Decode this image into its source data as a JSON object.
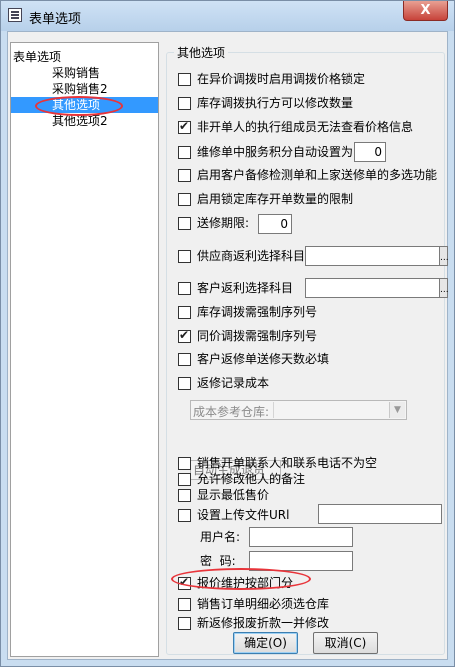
{
  "window": {
    "title": "表单选项",
    "close": "X"
  },
  "tree": {
    "root": "表单选项",
    "items": [
      "采购销售",
      "采购销售2",
      "其他选项",
      "其他选项2"
    ],
    "selected_index": 2
  },
  "group": {
    "title": "其他选项"
  },
  "options": {
    "o1": {
      "label": "在异价调拨时启用调拨价格锁定",
      "checked": false
    },
    "o2": {
      "label": "库存调拨执行方可以修改数量",
      "checked": false
    },
    "o3": {
      "label": "非开单人的执行组成员无法查看价格信息",
      "checked": true
    },
    "o4": {
      "label": "维修单中服务积分自动设置为",
      "checked": false,
      "value": "0"
    },
    "o5": {
      "label": "启用客户备修检测单和上家送修单的多选功能",
      "checked": false
    },
    "o6": {
      "label": "启用锁定库存开单数量的限制",
      "checked": false
    },
    "o7": {
      "label": "送修期限:",
      "checked": false,
      "value": "0"
    },
    "o8": {
      "label": "供应商返利选择科目",
      "checked": false,
      "value": ""
    },
    "o9": {
      "label": "客户返利选择科目",
      "checked": false,
      "value": ""
    },
    "o10": {
      "label": "库存调拨需强制序列号",
      "checked": false
    },
    "o11": {
      "label": "同价调拨需强制序列号",
      "checked": true
    },
    "o12": {
      "label": "客户返修单送修天数必填",
      "checked": false
    },
    "o13": {
      "label": "返修记录成本",
      "checked": false
    },
    "cost_warehouse_label": "成本参考仓库:",
    "cost_warehouse_value": "",
    "auto_return_label": "自动生成退货",
    "o14": {
      "label": "销售开单联系人和联系电话不为空",
      "checked": false
    },
    "o15": {
      "label": "允许修改他人的备注",
      "checked": false
    },
    "o16": {
      "label": "显示最低售价",
      "checked": false
    },
    "o17": {
      "label": "设置上传文件URl",
      "checked": false,
      "value": ""
    },
    "username_label": "用户名:",
    "username_value": "",
    "password_label": "密  码:",
    "password_value": "",
    "o18": {
      "label": "报价维护按部门分",
      "checked": true
    },
    "o19": {
      "label": "销售订单明细必须选仓库",
      "checked": false
    },
    "o20": {
      "label": "新返修报废折款一并修改",
      "checked": false
    }
  },
  "buttons": {
    "ok": "确定(O)",
    "cancel": "取消(C)"
  },
  "annotation_color": "#e8343a"
}
